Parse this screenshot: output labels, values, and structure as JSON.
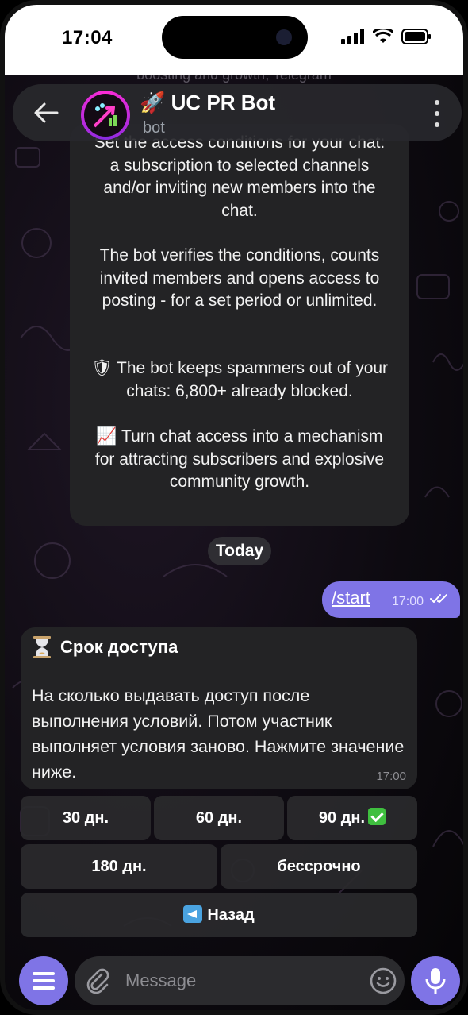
{
  "status_bar": {
    "time": "17:04"
  },
  "header": {
    "bot_name": "🚀 UC PR Bot",
    "subtitle": "bot",
    "ghost_text": "boosting and growth, Telegram"
  },
  "messages": {
    "intro": {
      "p1": "Set the access conditions for your chat: a subscription to selected channels and/or inviting new members into the chat.",
      "p2": "The bot verifies the conditions, counts invited members and opens access to posting - for a set period or unlimited.",
      "p3": "🛡 The bot keeps spammers out of your chats: 6,800+ already blocked.",
      "p4": "📈 Turn chat access into a mechanism for attracting subscribers and explosive community growth."
    },
    "date_separator": "Today",
    "outgoing": {
      "text": "/start",
      "time": "17:00"
    },
    "access_term": {
      "title": "Срок доступа",
      "body": "На сколько выдавать доступ после выполнения условий. Потом участник выполняет условия заново. Нажмите значение ниже.",
      "time": "17:00"
    }
  },
  "keyboard": {
    "opt_30": "30 дн.",
    "opt_60": "60 дн.",
    "opt_90": "90 дн.",
    "opt_180": "180 дн.",
    "opt_unlimited": "бессрочно",
    "back": "Назад",
    "selected": "90 дн."
  },
  "composer": {
    "placeholder": "Message"
  },
  "colors": {
    "accent": "#7f74e6",
    "bubble": "#232325",
    "check": "#3fbf3f"
  },
  "icons": [
    "back-arrow-icon",
    "kebab-menu-icon",
    "hourglass-icon",
    "checkmark-icon",
    "back-arrow-emoji-icon",
    "menu-icon",
    "paperclip-icon",
    "emoji-icon",
    "microphone-icon",
    "double-check-icon"
  ]
}
